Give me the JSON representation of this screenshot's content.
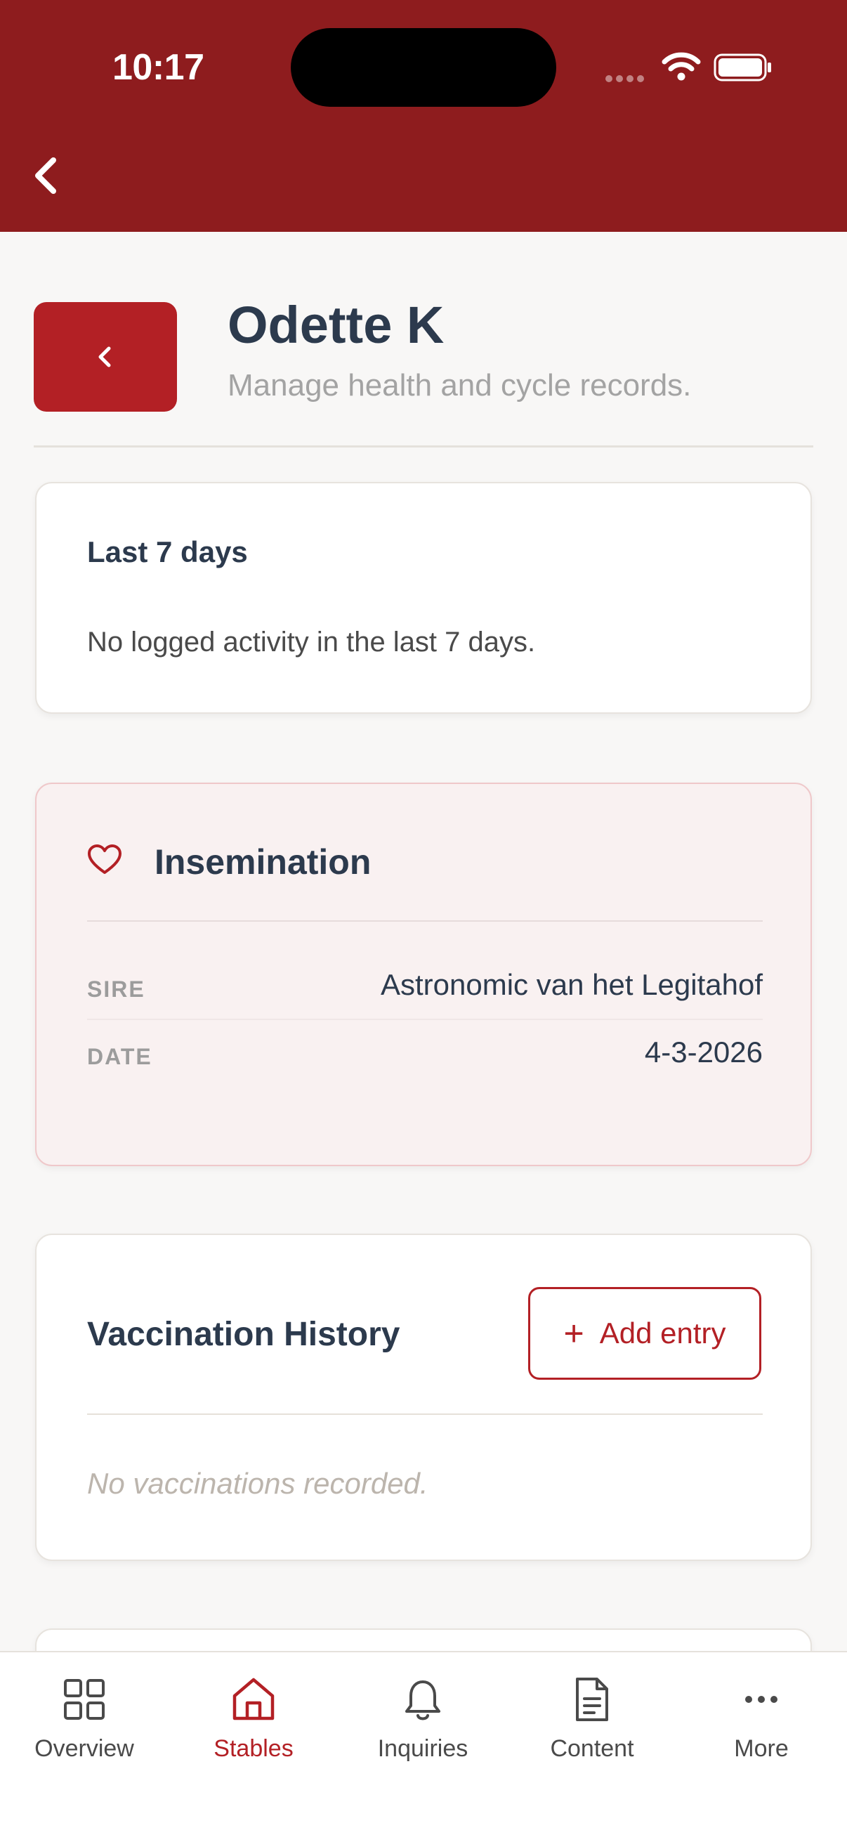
{
  "status_bar": {
    "time": "10:17"
  },
  "header": {
    "title": "Odette K",
    "subtitle": "Manage health and cycle records."
  },
  "activity_card": {
    "title": "Last 7 days",
    "empty_text": "No logged activity in the last 7 days."
  },
  "insemination_card": {
    "title": "Insemination",
    "icon": "heart-icon",
    "rows": [
      {
        "key": "SIRE",
        "value": "Astronomic van het Legitahof"
      },
      {
        "key": "DATE",
        "value": "4-3-2026"
      }
    ]
  },
  "vaccination_card": {
    "title": "Vaccination History",
    "add_label": "Add entry",
    "empty_text": "No vaccinations recorded."
  },
  "tabs": [
    {
      "label": "Overview",
      "icon": "grid-icon",
      "active": false
    },
    {
      "label": "Stables",
      "icon": "home-icon",
      "active": true
    },
    {
      "label": "Inquiries",
      "icon": "bell-icon",
      "active": false
    },
    {
      "label": "Content",
      "icon": "document-icon",
      "active": false
    },
    {
      "label": "More",
      "icon": "more-dots-icon",
      "active": false
    }
  ],
  "colors": {
    "brand_dark": "#8e1c1e",
    "brand": "#b32025",
    "text_primary": "#2c3a4d",
    "insemination_bg": "#f9f1f1"
  }
}
